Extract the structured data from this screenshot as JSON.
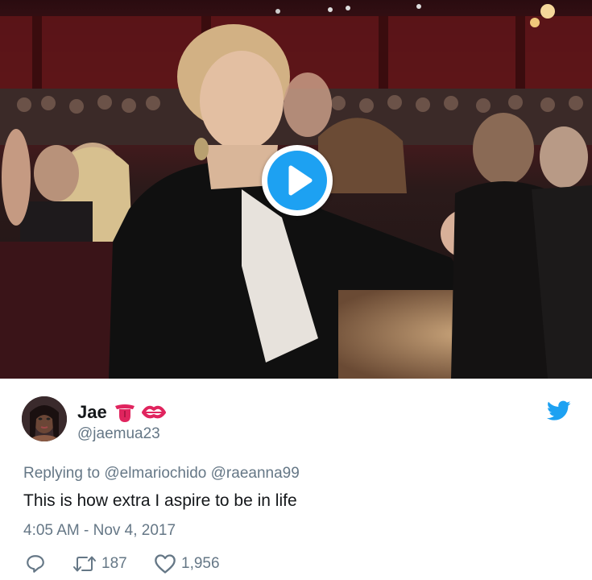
{
  "tweet": {
    "display_name": "Jae",
    "emojis": [
      "tongue-emoji",
      "kiss-mark-emoji"
    ],
    "username": "@jaemua23",
    "replying_prefix": "Replying to",
    "mentions": [
      "@elmariochido",
      "@raeanna99"
    ],
    "text": "This is how extra I aspire to be in life",
    "timestamp": "4:05 AM - Nov 4, 2017"
  },
  "actions": {
    "reply_count": "",
    "retweet_count": "187",
    "like_count": "1,956"
  },
  "icons": {
    "play": "play-icon",
    "twitter": "twitter-bird-icon",
    "reply": "reply-icon",
    "retweet": "retweet-icon",
    "like": "heart-icon"
  },
  "colors": {
    "accent": "#1da1f2",
    "text": "#14171a",
    "secondary": "#657786",
    "emoji_red": "#e0245e"
  }
}
